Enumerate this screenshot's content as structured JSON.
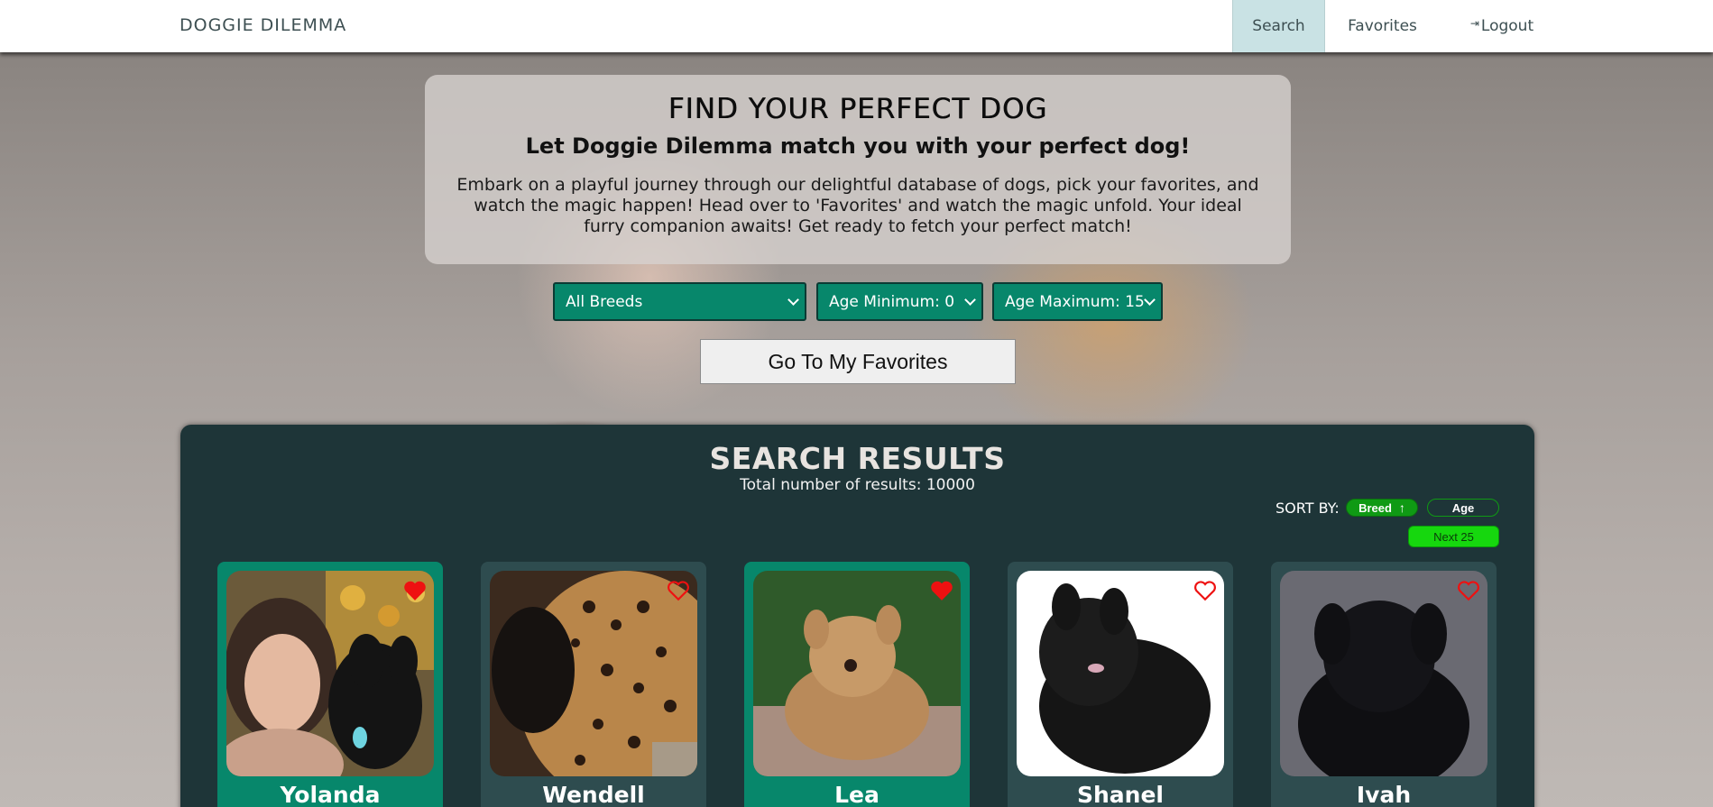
{
  "nav": {
    "brand": "DOGGIE DILEMMA",
    "search": "Search",
    "favorites": "Favorites",
    "logout": "Logout"
  },
  "hero": {
    "title": "FIND YOUR PERFECT DOG",
    "subtitle": "Let Doggie Dilemma match you with your perfect dog!",
    "body": "Embark on a playful journey through our delightful database of dogs, pick your favorites, and watch the magic happen! Head over to 'Favorites' and watch the magic unfold. Your ideal furry companion awaits! Get ready to fetch your perfect match!"
  },
  "filters": {
    "breed": "All Breeds",
    "age_min": "Age Minimum: 0",
    "age_max": "Age Maximum: 15"
  },
  "go_to_favorites": "Go To My Favorites",
  "results": {
    "title": "SEARCH RESULTS",
    "count": "Total number of results: 10000",
    "sort_label": "SORT BY:",
    "sort_breed": "Breed",
    "sort_age": "Age",
    "next": "Next 25"
  },
  "dogs": [
    {
      "name": "Yolanda",
      "favorited": true
    },
    {
      "name": "Wendell",
      "favorited": false
    },
    {
      "name": "Lea",
      "favorited": true
    },
    {
      "name": "Shanel",
      "favorited": false
    },
    {
      "name": "Ivah",
      "favorited": false
    }
  ],
  "colors": {
    "accent": "#07876b",
    "panel": "#1e3538",
    "heart": "#ee1111",
    "sort_active": "#0f9a14"
  }
}
